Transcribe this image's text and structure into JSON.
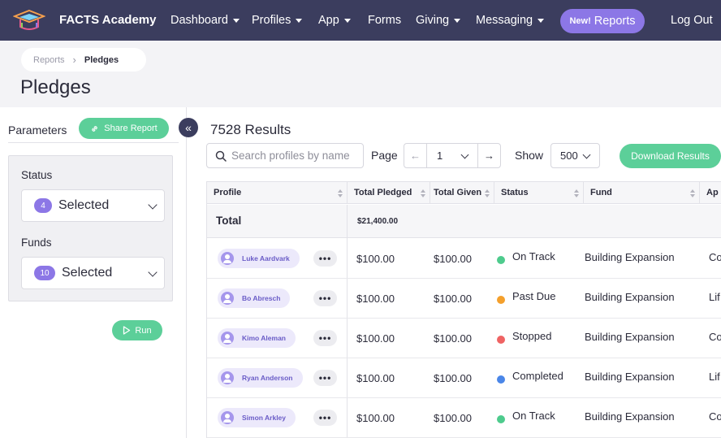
{
  "nav": {
    "brand": "FACTS Academy",
    "items": [
      {
        "label": "Dashboard",
        "caret": true
      },
      {
        "label": "Profiles",
        "caret": true
      },
      {
        "label": "App",
        "caret": true
      },
      {
        "label": "Forms",
        "caret": false
      },
      {
        "label": "Giving",
        "caret": true
      },
      {
        "label": "Messaging",
        "caret": true
      }
    ],
    "new_badge": "New!",
    "reports_label": "Reports",
    "logout_label": "Log Out"
  },
  "breadcrumb": {
    "parent": "Reports",
    "current": "Pledges"
  },
  "page_title": "Pledges",
  "parameters": {
    "title": "Parameters",
    "share_label": "Share Report",
    "collapse_icon": "«",
    "status": {
      "label": "Status",
      "count": "4",
      "value": "Selected"
    },
    "funds": {
      "label": "Funds",
      "count": "10",
      "value": "Selected"
    },
    "run_label": "Run"
  },
  "results": {
    "title": "7528 Results",
    "search_placeholder": "Search profiles by name",
    "page_label": "Page",
    "page_value": "1",
    "show_label": "Show",
    "show_value": "500",
    "download_label": "Download Results"
  },
  "table": {
    "columns": [
      "Profile",
      "Total Pledged",
      "Total Given",
      "Status",
      "Fund",
      "Ap"
    ],
    "total_label": "Total",
    "total_amount": "$21,400.00",
    "rows": [
      {
        "name": "Luke Aardvark",
        "pledged": "$100.00",
        "given": "$100.00",
        "status": "On Track",
        "status_color": "#4ecb8d",
        "fund": "Building Expansion",
        "extra": "Co"
      },
      {
        "name": "Bo Abresch",
        "pledged": "$100.00",
        "given": "$100.00",
        "status": "Past Due",
        "status_color": "#f4a02c",
        "fund": "Building Expansion",
        "extra": "Lif"
      },
      {
        "name": "Kimo Aleman",
        "pledged": "$100.00",
        "given": "$100.00",
        "status": "Stopped",
        "status_color": "#ef6363",
        "fund": "Building Expansion",
        "extra": "Co"
      },
      {
        "name": "Ryan Anderson",
        "pledged": "$100.00",
        "given": "$100.00",
        "status": "Completed",
        "status_color": "#4a86e8",
        "fund": "Building Expansion",
        "extra": "Lif"
      },
      {
        "name": "Simon Arkley",
        "pledged": "$100.00",
        "given": "$100.00",
        "status": "On Track",
        "status_color": "#4ecb8d",
        "fund": "Building Expansion",
        "extra": "Co"
      }
    ]
  }
}
